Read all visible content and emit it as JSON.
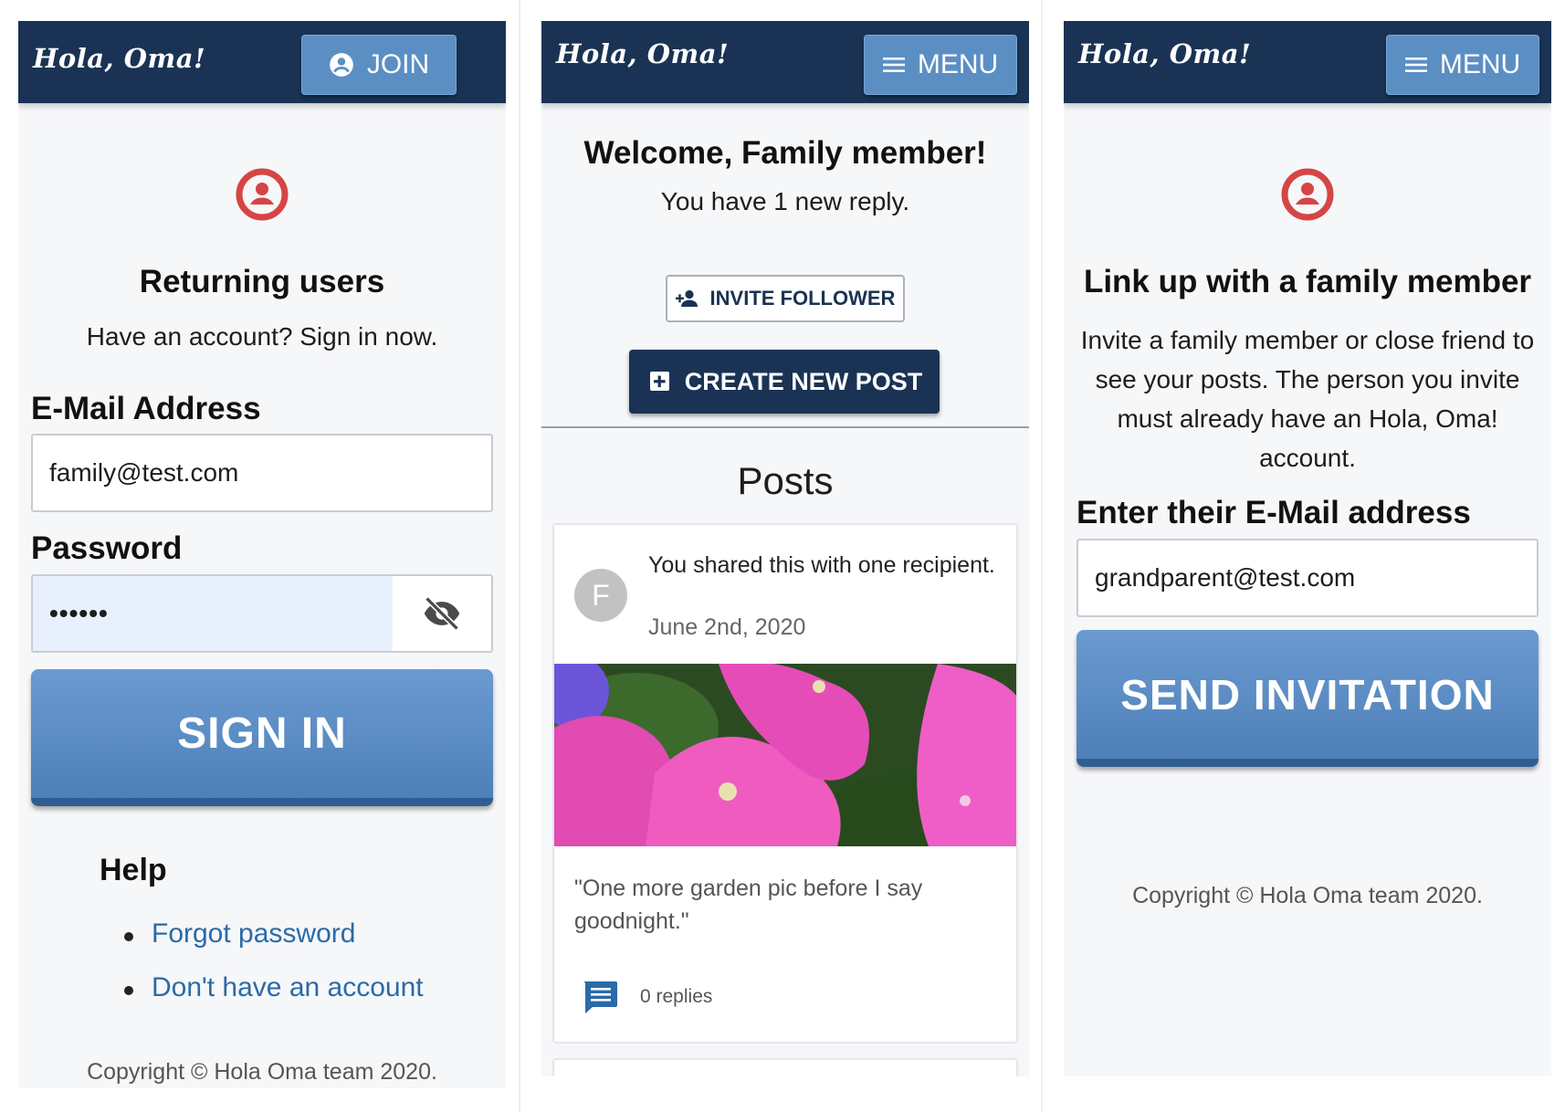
{
  "brand": "Hola, Oma!",
  "login": {
    "join_label": "JOIN",
    "heading": "Returning users",
    "subheading": "Have an account? Sign in now.",
    "email_label": "E-Mail Address",
    "email_value": "family@test.com",
    "password_label": "Password",
    "password_value": "••••••",
    "signin_label": "SIGN IN",
    "help_heading": "Help",
    "help_links": [
      "Forgot password",
      "Don't have an account"
    ],
    "copyright": "Copyright © Hola Oma team 2020."
  },
  "home": {
    "menu_label": "MENU",
    "welcome": "Welcome, Family member!",
    "new_reply": "You have 1 new reply.",
    "invite_label": "INVITE FOLLOWER",
    "create_label": "CREATE NEW POST",
    "posts_heading": "Posts",
    "post": {
      "avatar_letter": "F",
      "shared_text": "You shared this with one recipient.",
      "date": "June 2nd, 2020",
      "quote": "\"One more garden pic before I say goodnight.\"",
      "replies": "0 replies"
    }
  },
  "invite": {
    "menu_label": "MENU",
    "heading": "Link up with a family member",
    "body": "Invite a family member or close friend to see your posts. The person you invite must already have an Hola, Oma! account.",
    "email_label": "Enter their E-Mail address",
    "email_value": "grandparent@test.com",
    "send_label": "SEND INVITATION",
    "copyright": "Copyright © Hola Oma team 2020."
  },
  "colors": {
    "navbar": "#1a3354",
    "button_blue": "#5b8fc4",
    "accent_red": "#d64545",
    "link": "#2b6aa8"
  },
  "icons": [
    "user-circle-icon",
    "menu-icon",
    "eye-off-icon",
    "person-add-icon",
    "add-box-icon",
    "comment-icon"
  ]
}
